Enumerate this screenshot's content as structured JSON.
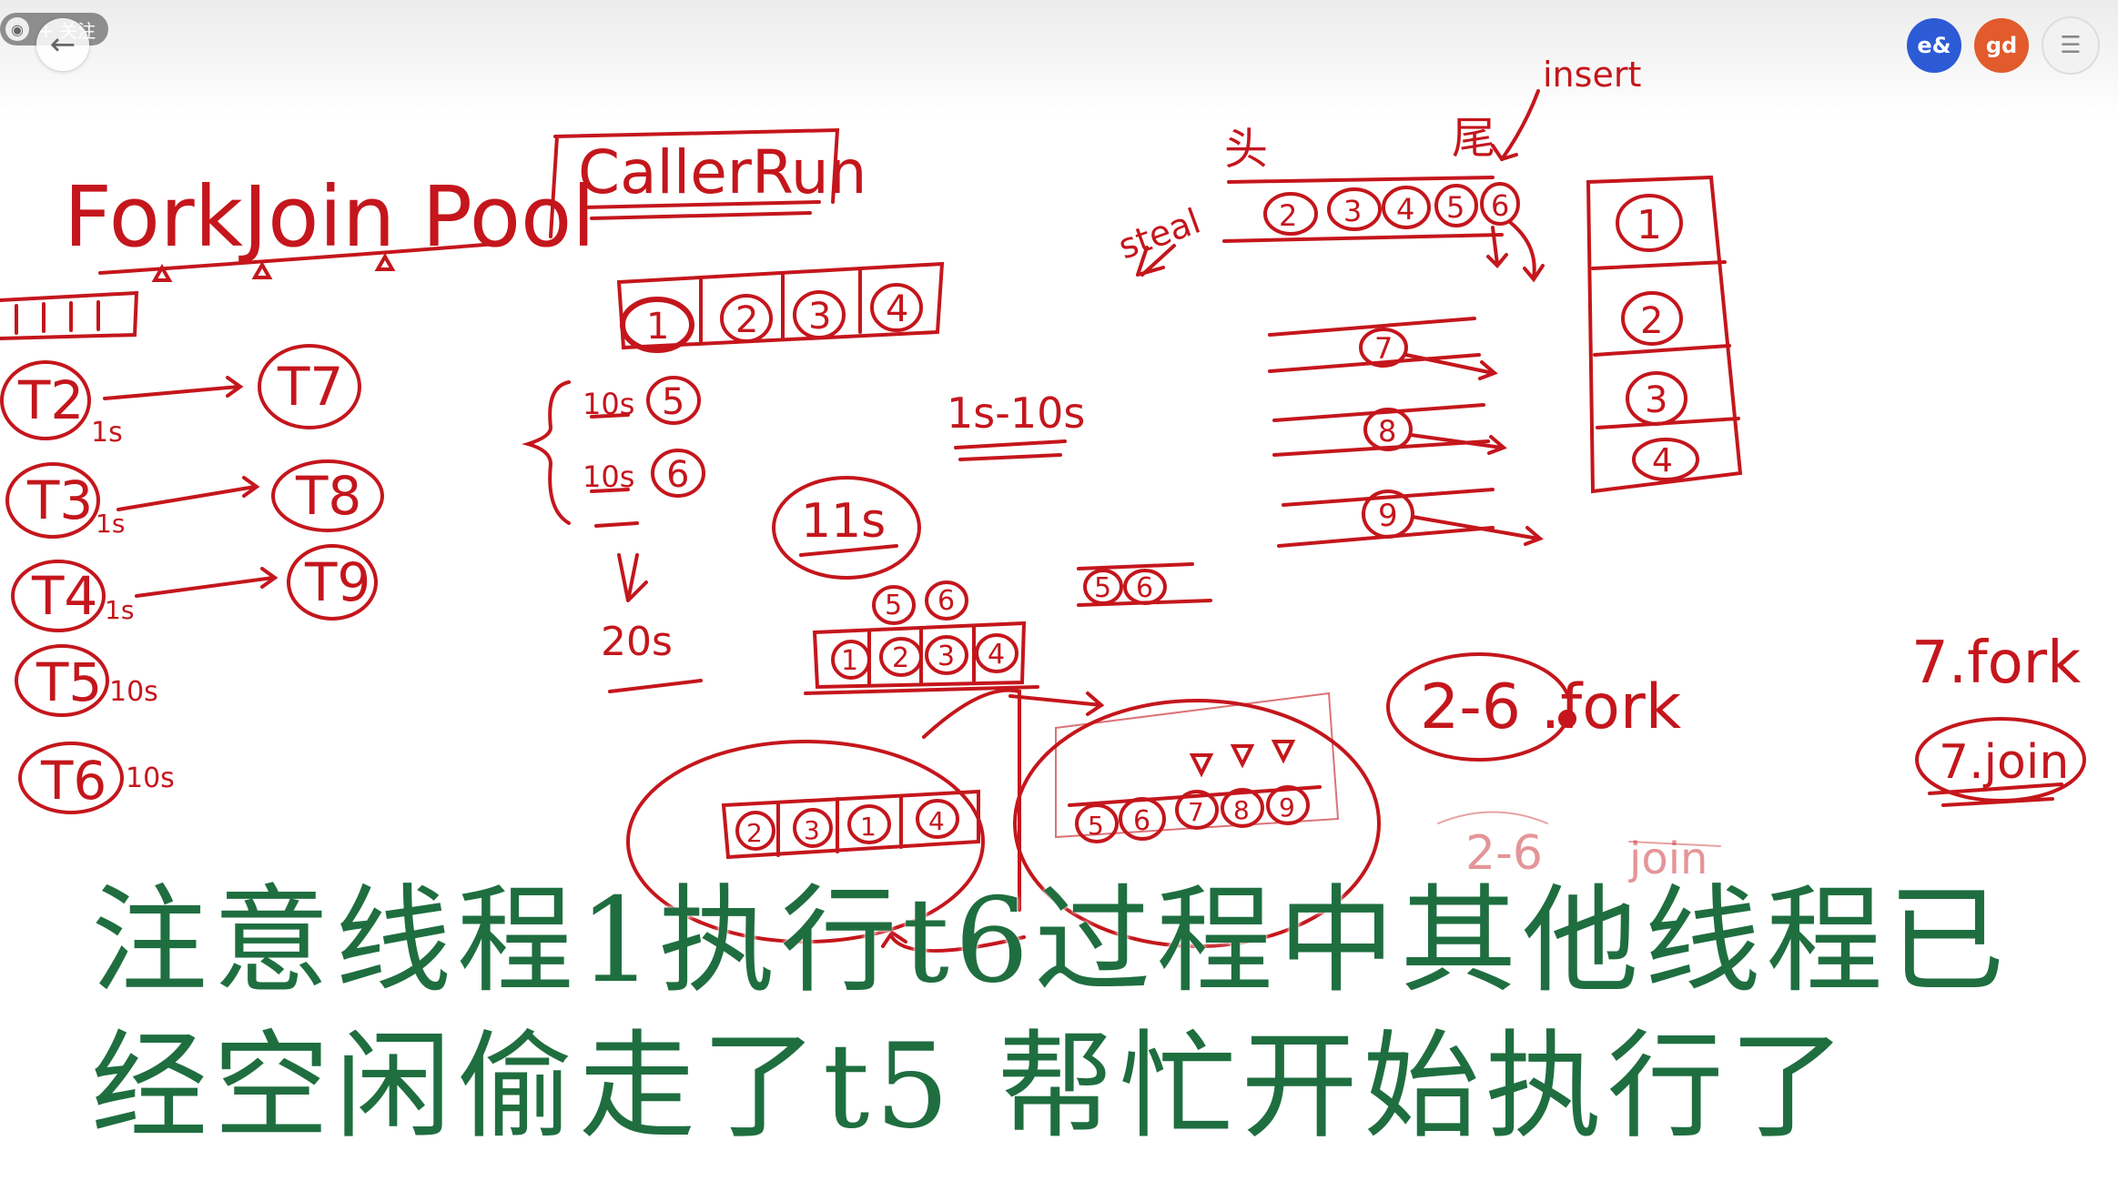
{
  "top_bar": {
    "follow_label": "+ 关注",
    "avatar_blue_text": "e&",
    "avatar_orange_text": "gd",
    "menu_icon": "menu-icon",
    "back_icon": "back-arrow-icon"
  },
  "board": {
    "title_forkjoin": "ForkJoin Pool",
    "title_caller": "CallerRun",
    "threads": [
      {
        "label": "T2",
        "time": "1s"
      },
      {
        "label": "T3",
        "time": "1s"
      },
      {
        "label": "T4",
        "time": "1s"
      },
      {
        "label": "T5",
        "time": "10s"
      },
      {
        "label": "T6",
        "time": "10s"
      }
    ],
    "targets": [
      "T7",
      "T8",
      "T9"
    ],
    "caller_queue": [
      "1",
      "2",
      "3",
      "4"
    ],
    "side_tasks": [
      {
        "time": "10s",
        "num": "5"
      },
      {
        "time": "10s",
        "num": "6"
      }
    ],
    "total_time": "20s",
    "range_label": "1s-10s",
    "circled_time": "11s",
    "head_label": "头",
    "tail_label": "尾",
    "insert_label": "insert",
    "steal_label": "steal",
    "deque_top": [
      "2",
      "3",
      "4",
      "5",
      "6"
    ],
    "deque_rows": [
      "7",
      "8",
      "9"
    ],
    "right_stack": [
      "1",
      "2",
      "3",
      "4"
    ],
    "mid_top": [
      "5",
      "6"
    ],
    "mid_queue": [
      "1",
      "2",
      "3",
      "4"
    ],
    "small_pair": [
      "5",
      "6"
    ],
    "bottom_left_queue": [
      "2",
      "3",
      "1",
      "4"
    ],
    "bottom_right_queue": [
      "5",
      "6",
      "7",
      "8",
      "9"
    ],
    "fork_label": "2-6 .fork",
    "fork7": "7.fork",
    "join7": "7.join",
    "faded_26": "2-6",
    "faded_join": "join"
  },
  "subtitle": {
    "line1": "注意线程1执行t6过程中其他线程已",
    "line2": "经空闲偷走了t5 帮忙开始执行了"
  },
  "colors": {
    "ink": "#c4161c",
    "subtitle": "#1f6e40"
  }
}
